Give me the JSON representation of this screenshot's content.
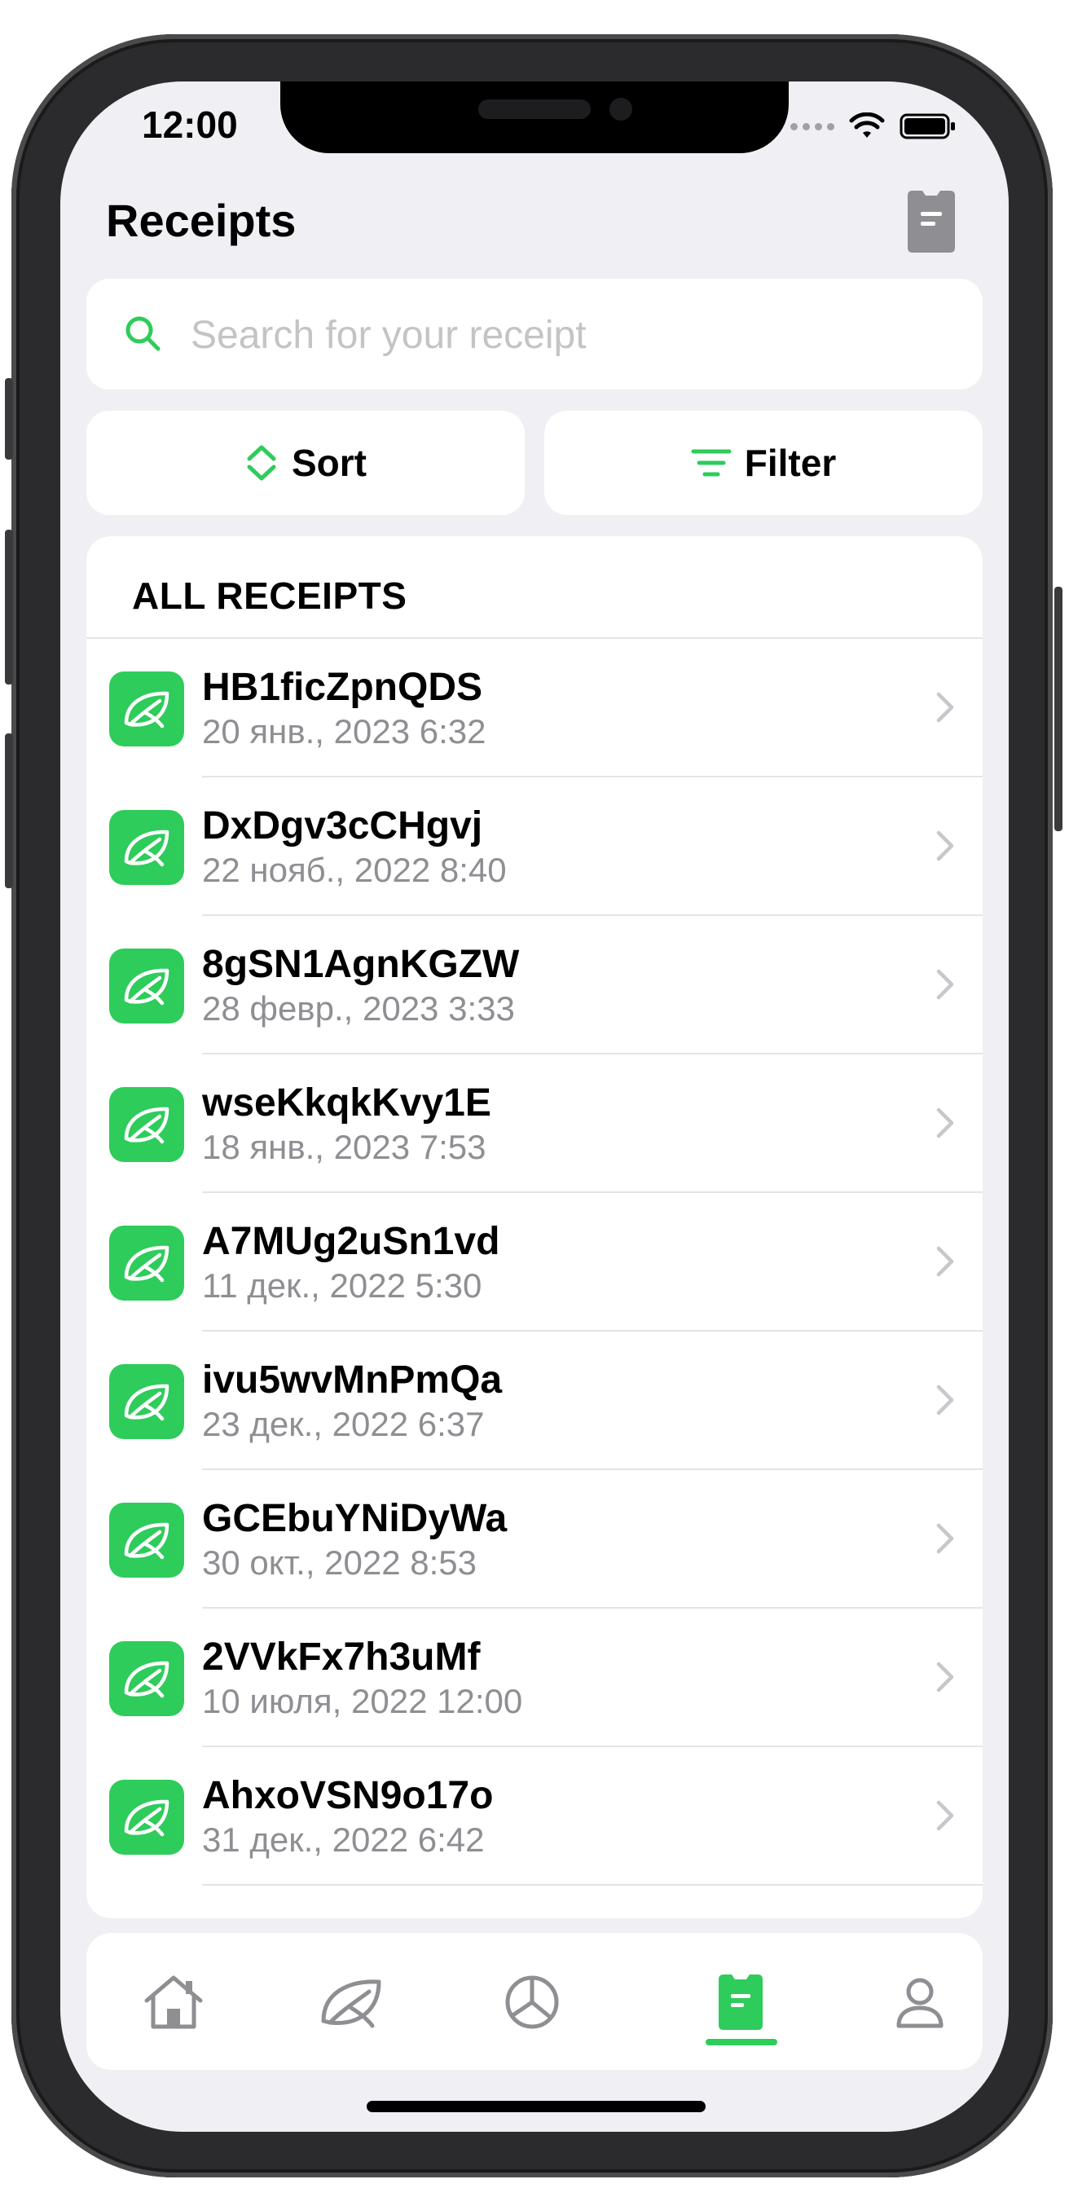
{
  "status_bar": {
    "time": "12:00"
  },
  "header": {
    "title": "Receipts",
    "action_icon": "receipt-icon"
  },
  "search": {
    "placeholder": "Search for your receipt"
  },
  "controls": {
    "sort_label": "Sort",
    "filter_label": "Filter"
  },
  "list": {
    "header": "ALL RECEIPTS",
    "items": [
      {
        "title": "HB1ficZpnQDS",
        "date": "20 янв., 2023 6:32"
      },
      {
        "title": "DxDgv3cCHgvj",
        "date": "22 нояб., 2022 8:40"
      },
      {
        "title": "8gSN1AgnKGZW",
        "date": "28 февр., 2023 3:33"
      },
      {
        "title": "wseKkqkKvy1E",
        "date": "18 янв., 2023 7:53"
      },
      {
        "title": "A7MUg2uSn1vd",
        "date": "11 дек., 2022 5:30"
      },
      {
        "title": "ivu5wvMnPmQa",
        "date": "23 дек., 2022 6:37"
      },
      {
        "title": "GCEbuYNiDyWa",
        "date": "30 окт., 2022 8:53"
      },
      {
        "title": "2VVkFx7h3uMf",
        "date": "10 июля, 2022 12:00"
      },
      {
        "title": "AhxoVSN9o17o",
        "date": "31 дек., 2022 6:42"
      }
    ]
  },
  "tabbar": {
    "tabs": [
      {
        "icon": "home-icon"
      },
      {
        "icon": "leaf-icon"
      },
      {
        "icon": "pie-chart-icon"
      },
      {
        "icon": "receipt-icon",
        "active": true
      },
      {
        "icon": "profile-icon"
      }
    ]
  },
  "colors": {
    "accent": "#2ecc5b",
    "background": "#efeff4",
    "secondary_text": "#8e8e93"
  }
}
